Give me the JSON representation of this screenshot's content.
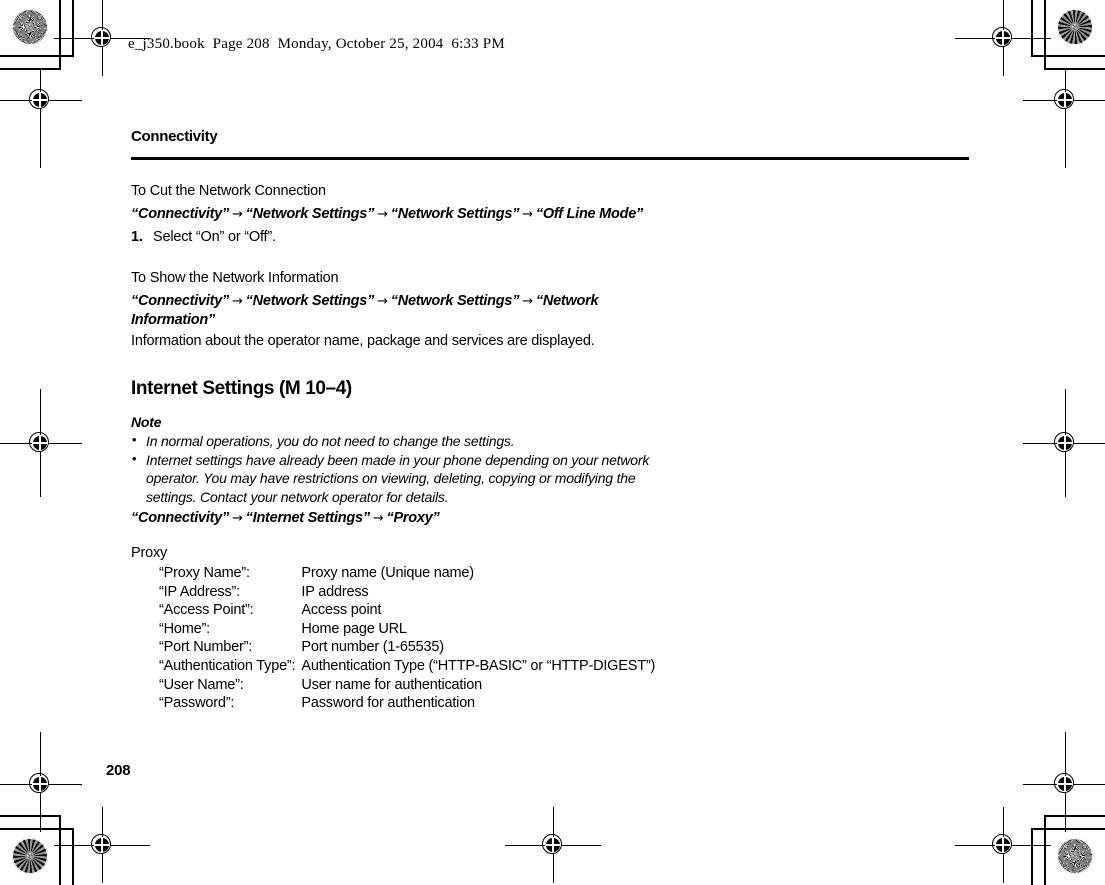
{
  "page": {
    "filestamp": "e_j350.book  Page 208  Monday, October 25, 2004  6:33 PM",
    "folio": "208",
    "running_head": "Connectivity"
  },
  "sections": {
    "cut_connection": {
      "subhead": "To Cut the Network Connection",
      "path": [
        "“Connectivity”",
        "“Network Settings”",
        "“Network Settings”",
        "“Off Line Mode”"
      ],
      "arrow": "→",
      "steps": [
        {
          "num": "1.",
          "text": "Select “On” or “Off”."
        }
      ]
    },
    "show_info": {
      "subhead": "To Show the Network Information",
      "path": [
        "“Connectivity”",
        "“Network Settings”",
        "“Network Settings”",
        "“Network Information”"
      ],
      "body": "Information about the operator name, package and services are displayed."
    },
    "internet_settings": {
      "heading": "Internet Settings (M 10–4)",
      "note_title": "Note",
      "notes": [
        "In normal operations, you do not need to change the settings.",
        "Internet settings have already been made in your phone depending on your network operator. You may have restrictions on viewing, deleting, copying or modifying the settings. Contact your network operator for details."
      ],
      "path": [
        "“Connectivity”",
        "“Internet Settings”",
        "“Proxy”"
      ],
      "proxy_label": "Proxy",
      "proxy_params": [
        {
          "key": "“Proxy Name”:",
          "value": "Proxy name (Unique name)"
        },
        {
          "key": "“IP Address”:",
          "value": "IP address"
        },
        {
          "key": "“Access Point”:",
          "value": "Access point"
        },
        {
          "key": "“Home”:",
          "value": "Home page URL"
        },
        {
          "key": "“Port Number”:",
          "value": "Port number (1-65535)"
        },
        {
          "key": "“Authentication Type”:",
          "value": "Authentication Type (“HTTP-BASIC” or “HTTP-DIGEST”)"
        },
        {
          "key": "“User Name”:",
          "value": "User name for authentication"
        },
        {
          "key": "“Password”:",
          "value": "Password for authentication"
        }
      ]
    }
  },
  "colors": {
    "ink": "#000000",
    "paper": "#ffffff"
  }
}
